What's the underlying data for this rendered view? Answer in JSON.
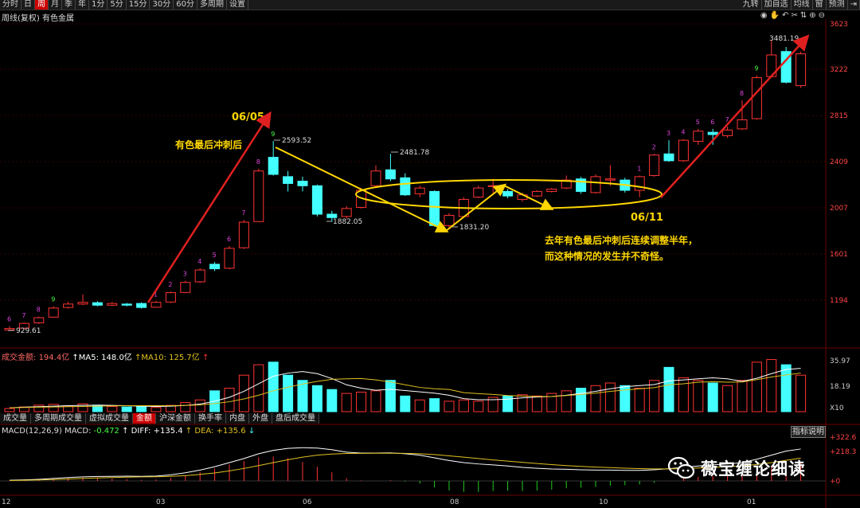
{
  "toolbar": {
    "tabs": [
      "分时",
      "日",
      "周",
      "月",
      "季",
      "年",
      "1分",
      "5分",
      "15分",
      "30分",
      "60分",
      "多周期",
      "设置"
    ],
    "active_tab": "周",
    "right_tabs": [
      "九转",
      "加自选",
      "均线",
      "窗",
      "预测"
    ]
  },
  "chart_title": "周线(复权)  有色金属",
  "price_axis": [
    "3623",
    "3222",
    "2815",
    "2409",
    "2007",
    "1601",
    "1194"
  ],
  "price_labels": {
    "high1": "2593.52",
    "high2": "2481.78",
    "low1": "1882.05",
    "low2": "1831.20",
    "start": "929.61",
    "top": "3481.19"
  },
  "annotations": {
    "date1": "06/05",
    "label1": "有色最后冲刺后",
    "date2": "06/11",
    "note_line1": "去年有色最后冲刺后连续调整半年，",
    "note_line2": "而这种情况的发生并不奇怪。"
  },
  "volume_header": {
    "name": "成交金额: ",
    "value": "194.4亿",
    "ma5_label": "MA5: ",
    "ma5": "148.0亿",
    "ma10_label": "MA10: ",
    "ma10": "125.7亿"
  },
  "volume_axis": [
    "35.97",
    "18.19",
    "X10"
  ],
  "bottom_tabs": [
    "成交量",
    "多周期成交量",
    "虚拟成交量",
    "金额",
    "沪深金额",
    "换手率",
    "内盘",
    "外盘",
    "盘后成交量"
  ],
  "active_bottom_tab": "金额",
  "macd_header": {
    "name": "MACD(12,26,9)",
    "macd_label": " MACD: ",
    "macd": "-0.472",
    "diff_label": " DIFF: ",
    "diff": "+135.4",
    "dea_label": " DEA: ",
    "dea": "+135.6"
  },
  "macd_axis": [
    "+322.6",
    "+218.3",
    "+0"
  ],
  "macd_button": "指标说明",
  "x_axis": [
    "12",
    "03",
    "06",
    "08",
    "10",
    "01"
  ],
  "watermark": "薇宝缠论细读",
  "colors": {
    "up": "#ff3333",
    "down": "#44ffff",
    "annotation": "#ffd700",
    "arrow_red": "#e02020",
    "ma5": "#ffffff",
    "ma10": "#e0c020"
  },
  "candles": [
    {
      "o": 932,
      "c": 945,
      "h": 965,
      "l": 925,
      "n": "6"
    },
    {
      "o": 948,
      "c": 990,
      "h": 998,
      "l": 940,
      "n": "7"
    },
    {
      "o": 995,
      "c": 1040,
      "h": 1050,
      "l": 985,
      "n": "8"
    },
    {
      "o": 1045,
      "c": 1125,
      "h": 1140,
      "l": 1040,
      "n": "9"
    },
    {
      "o": 1130,
      "c": 1160,
      "h": 1180,
      "l": 1120,
      "n": ""
    },
    {
      "o": 1160,
      "c": 1175,
      "h": 1245,
      "l": 1150,
      "n": ""
    },
    {
      "o": 1172,
      "c": 1150,
      "h": 1185,
      "l": 1140,
      "n": ""
    },
    {
      "o": 1150,
      "c": 1165,
      "h": 1178,
      "l": 1142,
      "n": ""
    },
    {
      "o": 1160,
      "c": 1150,
      "h": 1170,
      "l": 1140,
      "n": ""
    },
    {
      "o": 1165,
      "c": 1130,
      "h": 1175,
      "l": 1120,
      "n": ""
    },
    {
      "o": 1132,
      "c": 1175,
      "h": 1185,
      "l": 1128,
      "n": "1"
    },
    {
      "o": 1178,
      "c": 1260,
      "h": 1270,
      "l": 1170,
      "n": "2"
    },
    {
      "o": 1262,
      "c": 1350,
      "h": 1365,
      "l": 1255,
      "n": "3"
    },
    {
      "o": 1355,
      "c": 1460,
      "h": 1475,
      "l": 1345,
      "n": "4"
    },
    {
      "o": 1510,
      "c": 1470,
      "h": 1530,
      "l": 1450,
      "n": "5"
    },
    {
      "o": 1475,
      "c": 1650,
      "h": 1670,
      "l": 1465,
      "n": "6"
    },
    {
      "o": 1655,
      "c": 1880,
      "h": 1900,
      "l": 1645,
      "n": "7"
    },
    {
      "o": 1885,
      "c": 2330,
      "h": 2350,
      "l": 1880,
      "n": "8"
    },
    {
      "o": 2450,
      "c": 2300,
      "h": 2593,
      "l": 2290,
      "n": "9"
    },
    {
      "o": 2280,
      "c": 2220,
      "h": 2330,
      "l": 2150,
      "n": ""
    },
    {
      "o": 2240,
      "c": 2200,
      "h": 2280,
      "l": 2150,
      "n": ""
    },
    {
      "o": 2200,
      "c": 1950,
      "h": 2210,
      "l": 1930,
      "n": ""
    },
    {
      "o": 1950,
      "c": 1920,
      "h": 1980,
      "l": 1882,
      "n": ""
    },
    {
      "o": 1930,
      "c": 2000,
      "h": 2020,
      "l": 1910,
      "n": ""
    },
    {
      "o": 2010,
      "c": 2160,
      "h": 2180,
      "l": 2000,
      "n": ""
    },
    {
      "o": 2200,
      "c": 2330,
      "h": 2380,
      "l": 2190,
      "n": ""
    },
    {
      "o": 2340,
      "c": 2260,
      "h": 2481,
      "l": 2240,
      "n": ""
    },
    {
      "o": 2270,
      "c": 2120,
      "h": 2310,
      "l": 2110,
      "n": ""
    },
    {
      "o": 2130,
      "c": 2180,
      "h": 2200,
      "l": 2100,
      "n": ""
    },
    {
      "o": 2150,
      "c": 1850,
      "h": 2160,
      "l": 1840,
      "n": ""
    },
    {
      "o": 1850,
      "c": 1940,
      "h": 1960,
      "l": 1831,
      "n": ""
    },
    {
      "o": 1930,
      "c": 2080,
      "h": 2100,
      "l": 1920,
      "n": ""
    },
    {
      "o": 2100,
      "c": 2180,
      "h": 2200,
      "l": 2090,
      "n": ""
    },
    {
      "o": 2200,
      "c": 2200,
      "h": 2260,
      "l": 2130,
      "n": ""
    },
    {
      "o": 2150,
      "c": 2110,
      "h": 2170,
      "l": 2090,
      "n": ""
    },
    {
      "o": 2080,
      "c": 2120,
      "h": 2140,
      "l": 2060,
      "n": ""
    },
    {
      "o": 2110,
      "c": 2150,
      "h": 2160,
      "l": 2100,
      "n": ""
    },
    {
      "o": 2150,
      "c": 2170,
      "h": 2180,
      "l": 2140,
      "n": ""
    },
    {
      "o": 2180,
      "c": 2250,
      "h": 2290,
      "l": 2170,
      "n": ""
    },
    {
      "o": 2260,
      "c": 2150,
      "h": 2280,
      "l": 2130,
      "n": ""
    },
    {
      "o": 2140,
      "c": 2280,
      "h": 2300,
      "l": 2130,
      "n": ""
    },
    {
      "o": 2250,
      "c": 2260,
      "h": 2380,
      "l": 2200,
      "n": ""
    },
    {
      "o": 2250,
      "c": 2160,
      "h": 2270,
      "l": 2140,
      "n": ""
    },
    {
      "o": 2160,
      "c": 2280,
      "h": 2290,
      "l": 2100,
      "n": "1"
    },
    {
      "o": 2290,
      "c": 2470,
      "h": 2480,
      "l": 2280,
      "n": "2"
    },
    {
      "o": 2480,
      "c": 2420,
      "h": 2600,
      "l": 2410,
      "n": "3"
    },
    {
      "o": 2420,
      "c": 2600,
      "h": 2610,
      "l": 2410,
      "n": "4"
    },
    {
      "o": 2590,
      "c": 2680,
      "h": 2700,
      "l": 2560,
      "n": "5"
    },
    {
      "o": 2670,
      "c": 2650,
      "h": 2700,
      "l": 2560,
      "n": "6"
    },
    {
      "o": 2640,
      "c": 2690,
      "h": 2720,
      "l": 2620,
      "n": "7"
    },
    {
      "o": 2700,
      "c": 2780,
      "h": 2950,
      "l": 2690,
      "n": "8"
    },
    {
      "o": 2790,
      "c": 3150,
      "h": 3170,
      "l": 2780,
      "n": "9"
    },
    {
      "o": 3160,
      "c": 3350,
      "h": 3481,
      "l": 3150,
      "n": ""
    },
    {
      "o": 3380,
      "c": 3110,
      "h": 3420,
      "l": 3100,
      "n": ""
    },
    {
      "o": 3080,
      "c": 3360,
      "h": 3380,
      "l": 3060,
      "n": ""
    }
  ],
  "volumes": [
    1.2,
    1.8,
    2.5,
    2.8,
    2.2,
    3.0,
    2.5,
    2.0,
    1.8,
    2.2,
    1.6,
    2.4,
    3.5,
    4.5,
    8.0,
    9.0,
    14.0,
    18.0,
    19.0,
    14.0,
    12.0,
    10.0,
    8.5,
    7.0,
    7.5,
    8.0,
    12.0,
    6.0,
    4.5,
    5.0,
    4.0,
    4.5,
    4.0,
    5.5,
    6.0,
    6.5,
    6.0,
    7.0,
    8.0,
    9.0,
    10.0,
    11.0,
    10.0,
    9.0,
    12.0,
    17.0,
    13.0,
    12.0,
    11.0,
    10.0,
    12.0,
    19.0,
    20.0,
    18.0,
    14.0
  ],
  "ma5": [
    1.5,
    1.7,
    1.9,
    2.1,
    2.3,
    2.4,
    2.5,
    2.4,
    2.3,
    2.1,
    2.0,
    2.1,
    2.4,
    2.9,
    4.0,
    5.5,
    7.8,
    10.7,
    13.6,
    14.8,
    15.4,
    14.6,
    12.7,
    10.3,
    9.0,
    8.2,
    8.6,
    8.1,
    7.6,
    7.1,
    6.3,
    5.0,
    4.6,
    4.6,
    4.8,
    5.3,
    5.6,
    5.8,
    6.3,
    7.0,
    7.8,
    8.8,
    9.6,
    10.0,
    10.4,
    11.8,
    12.2,
    12.6,
    13.0,
    12.6,
    11.6,
    12.8,
    14.6,
    16.2,
    16.6
  ],
  "ma10": [
    1.5,
    1.6,
    1.7,
    1.8,
    1.9,
    2.0,
    2.1,
    2.2,
    2.3,
    2.3,
    2.3,
    2.3,
    2.4,
    2.6,
    3.1,
    3.8,
    4.9,
    6.3,
    8.0,
    9.4,
    10.6,
    11.6,
    12.4,
    12.6,
    12.7,
    12.2,
    11.4,
    10.3,
    9.3,
    8.8,
    8.5,
    7.3,
    6.9,
    6.6,
    6.2,
    6.0,
    5.8,
    5.8,
    6.2,
    6.6,
    7.1,
    7.8,
    8.3,
    8.8,
    9.2,
    10.3,
    10.7,
    11.3,
    11.5,
    11.3,
    11.4,
    12.3,
    13.3,
    14.1,
    14.8
  ],
  "macd_diff": [
    5,
    8,
    12,
    18,
    25,
    30,
    33,
    34,
    35,
    34,
    36,
    45,
    60,
    80,
    105,
    135,
    165,
    200,
    225,
    240,
    245,
    242,
    230,
    212,
    205,
    205,
    207,
    200,
    190,
    170,
    150,
    135,
    125,
    118,
    110,
    100,
    93,
    88,
    86,
    82,
    80,
    80,
    78,
    78,
    82,
    90,
    100,
    110,
    118,
    125,
    135,
    160,
    190,
    220,
    235
  ],
  "macd_dea": [
    3,
    5,
    7,
    10,
    14,
    18,
    22,
    25,
    28,
    30,
    31,
    34,
    39,
    48,
    59,
    74,
    92,
    113,
    135,
    156,
    175,
    190,
    198,
    202,
    203,
    204,
    204,
    203,
    200,
    194,
    185,
    175,
    165,
    155,
    146,
    137,
    128,
    120,
    113,
    107,
    102,
    98,
    94,
    91,
    89,
    89,
    91,
    95,
    100,
    105,
    111,
    121,
    135,
    152,
    168
  ]
}
